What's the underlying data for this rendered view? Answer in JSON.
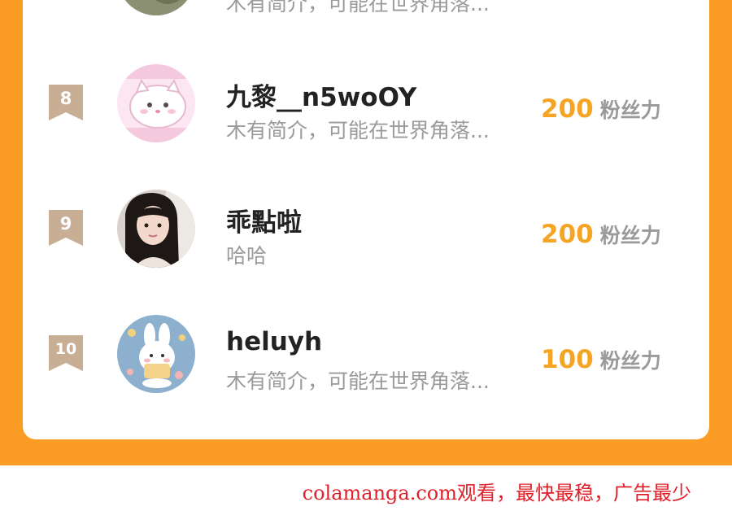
{
  "colors": {
    "background": "#fb9d25",
    "card": "#ffffff",
    "badge": "#c8ae94",
    "score": "#f5a523",
    "muted_text": "#9a9a9a",
    "name_text": "#222222",
    "watermark": "#e0202a"
  },
  "ranking": {
    "partial_top_row": {
      "bio": "木有简介，可能在世界角落..."
    },
    "rows": [
      {
        "rank": "8",
        "name": "九黎__n5woOY",
        "bio": "木有简介，可能在世界角落...",
        "score": "200",
        "unit": "粉丝力",
        "avatar": "cartoon-cat-avatar"
      },
      {
        "rank": "9",
        "name": "乖點啦",
        "bio": "哈哈",
        "score": "200",
        "unit": "粉丝力",
        "avatar": "girl-photo-avatar"
      },
      {
        "rank": "10",
        "name": "heluyh",
        "bio": "木有简介，可能在世界角落...",
        "score": "100",
        "unit": "粉丝力",
        "avatar": "bunny-illustration-avatar"
      }
    ]
  },
  "watermark": "colamanga.com观看，最快最稳，广告最少"
}
